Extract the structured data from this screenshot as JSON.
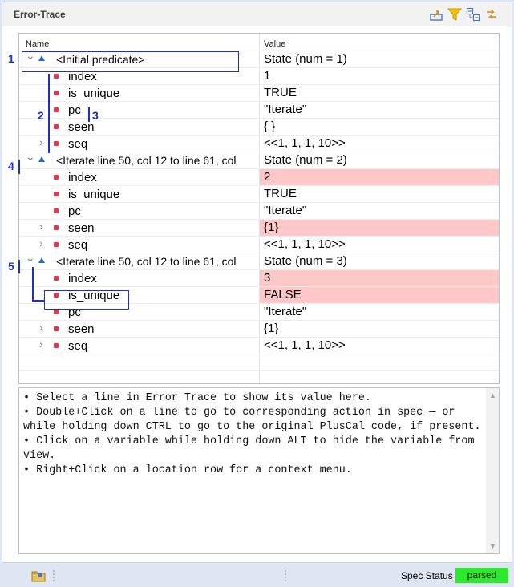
{
  "panel": {
    "title": "Error-Trace"
  },
  "toolbar": {
    "icons": [
      "export-icon",
      "filter-icon",
      "collapse-all-icon",
      "link-icon"
    ]
  },
  "tree": {
    "col_name": "Name",
    "col_value": "Value",
    "rows": [
      {
        "name": "<Initial predicate>",
        "value": "State (num = 1)",
        "kind": "state",
        "highlight": false
      },
      {
        "name": "index",
        "value": "1",
        "kind": "var",
        "expandable": false,
        "highlight": false
      },
      {
        "name": "is_unique",
        "value": "TRUE",
        "kind": "var",
        "expandable": false,
        "highlight": false
      },
      {
        "name": "pc",
        "value": "\"Iterate\"",
        "kind": "var",
        "expandable": false,
        "highlight": false
      },
      {
        "name": "seen",
        "value": "{ }",
        "kind": "var",
        "expandable": false,
        "highlight": false
      },
      {
        "name": "seq",
        "value": "<<1, 1, 1, 10>>",
        "kind": "var",
        "expandable": true,
        "highlight": false
      },
      {
        "name": "<Iterate line 50, col 12 to line 61, col",
        "value": "State (num = 2)",
        "kind": "state",
        "highlight": false
      },
      {
        "name": "index",
        "value": "2",
        "kind": "var",
        "expandable": false,
        "highlight": true
      },
      {
        "name": "is_unique",
        "value": "TRUE",
        "kind": "var",
        "expandable": false,
        "highlight": false
      },
      {
        "name": "pc",
        "value": "\"Iterate\"",
        "kind": "var",
        "expandable": false,
        "highlight": false
      },
      {
        "name": "seen",
        "value": "{1}",
        "kind": "var",
        "expandable": true,
        "highlight": true
      },
      {
        "name": "seq",
        "value": "<<1, 1, 1, 10>>",
        "kind": "var",
        "expandable": true,
        "highlight": false
      },
      {
        "name": "<Iterate line 50, col 12 to line 61, col",
        "value": "State (num = 3)",
        "kind": "state",
        "highlight": false
      },
      {
        "name": "index",
        "value": "3",
        "kind": "var",
        "expandable": false,
        "highlight": true
      },
      {
        "name": "is_unique",
        "value": "FALSE",
        "kind": "var",
        "expandable": false,
        "highlight": true
      },
      {
        "name": "pc",
        "value": "\"Iterate\"",
        "kind": "var",
        "expandable": false,
        "highlight": false
      },
      {
        "name": "seen",
        "value": "{1}",
        "kind": "var",
        "expandable": true,
        "highlight": false
      },
      {
        "name": "seq",
        "value": "<<1, 1, 1, 10>>",
        "kind": "var",
        "expandable": true,
        "highlight": false
      }
    ]
  },
  "annotations": [
    "1",
    "2",
    "3",
    "4",
    "5"
  ],
  "info": {
    "text": "• Select a line in Error Trace to show its value here.\n• Double+Click on a line to go to corresponding action in spec — or while holding down CTRL to go to the original PlusCal code, if present.\n• Click on a variable while holding down ALT to hide the variable from view.\n• Right+Click on a location row for a context menu."
  },
  "status": {
    "spec_label": "Spec Status :",
    "spec_value": "parsed",
    "spec_color": "#2ee82e"
  }
}
